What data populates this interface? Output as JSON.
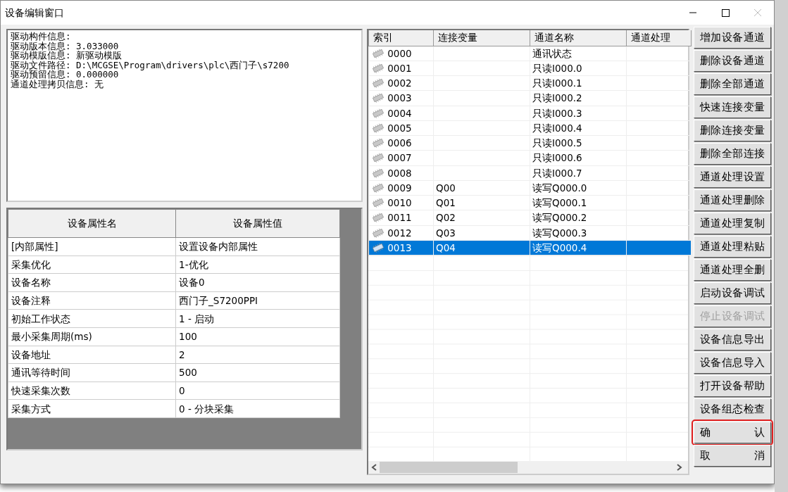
{
  "window": {
    "title": "设备编辑窗口"
  },
  "info_lines": [
    "驱动构件信息:",
    "驱动版本信息: 3.033000",
    "驱动模版信息: 新驱动模版",
    "驱动文件路径: D:\\MCGSE\\Program\\drivers\\plc\\西门子\\s7200",
    "驱动预留信息: 0.000000",
    "通道处理拷贝信息: 无"
  ],
  "properties": {
    "columns": [
      "设备属性名",
      "设备属性值"
    ],
    "rows": [
      [
        "[内部属性]",
        "设置设备内部属性"
      ],
      [
        "采集优化",
        "1-优化"
      ],
      [
        "设备名称",
        "设备0"
      ],
      [
        "设备注释",
        "西门子_S7200PPI"
      ],
      [
        "初始工作状态",
        "1 - 启动"
      ],
      [
        "最小采集周期(ms)",
        "100"
      ],
      [
        "设备地址",
        "2"
      ],
      [
        "通讯等待时间",
        "500"
      ],
      [
        "快速采集次数",
        "0"
      ],
      [
        "采集方式",
        "0 - 分块采集"
      ]
    ]
  },
  "channels": {
    "columns": [
      "索引",
      "连接变量",
      "通道名称",
      "通道处理"
    ],
    "rows": [
      {
        "index": "0000",
        "variable": "",
        "name": "通讯状态",
        "selected": false
      },
      {
        "index": "0001",
        "variable": "",
        "name": "只读I000.0",
        "selected": false
      },
      {
        "index": "0002",
        "variable": "",
        "name": "只读I000.1",
        "selected": false
      },
      {
        "index": "0003",
        "variable": "",
        "name": "只读I000.2",
        "selected": false
      },
      {
        "index": "0004",
        "variable": "",
        "name": "只读I000.3",
        "selected": false
      },
      {
        "index": "0005",
        "variable": "",
        "name": "只读I000.4",
        "selected": false
      },
      {
        "index": "0006",
        "variable": "",
        "name": "只读I000.5",
        "selected": false
      },
      {
        "index": "0007",
        "variable": "",
        "name": "只读I000.6",
        "selected": false
      },
      {
        "index": "0008",
        "variable": "",
        "name": "只读I000.7",
        "selected": false
      },
      {
        "index": "0009",
        "variable": "Q00",
        "name": "读写Q000.0",
        "selected": false
      },
      {
        "index": "0010",
        "variable": "Q01",
        "name": "读写Q000.1",
        "selected": false
      },
      {
        "index": "0011",
        "variable": "Q02",
        "name": "读写Q000.2",
        "selected": false
      },
      {
        "index": "0012",
        "variable": "Q03",
        "name": "读写Q000.3",
        "selected": false
      },
      {
        "index": "0013",
        "variable": "Q04",
        "name": "读写Q000.4",
        "selected": true
      }
    ]
  },
  "buttons": [
    {
      "kind": "text",
      "label": "增加设备通道",
      "disabled": false,
      "highlighted": false
    },
    {
      "kind": "text",
      "label": "删除设备通道",
      "disabled": false,
      "highlighted": false
    },
    {
      "kind": "text",
      "label": "删除全部通道",
      "disabled": false,
      "highlighted": false
    },
    {
      "kind": "text",
      "label": "快速连接变量",
      "disabled": false,
      "highlighted": false
    },
    {
      "kind": "text",
      "label": "删除连接变量",
      "disabled": false,
      "highlighted": false
    },
    {
      "kind": "text",
      "label": "删除全部连接",
      "disabled": false,
      "highlighted": false
    },
    {
      "kind": "text",
      "label": "通道处理设置",
      "disabled": false,
      "highlighted": false
    },
    {
      "kind": "text",
      "label": "通道处理删除",
      "disabled": false,
      "highlighted": false
    },
    {
      "kind": "text",
      "label": "通道处理复制",
      "disabled": false,
      "highlighted": false
    },
    {
      "kind": "text",
      "label": "通道处理粘贴",
      "disabled": false,
      "highlighted": false
    },
    {
      "kind": "text",
      "label": "通道处理全删",
      "disabled": false,
      "highlighted": false
    },
    {
      "kind": "text",
      "label": "启动设备调试",
      "disabled": false,
      "highlighted": false
    },
    {
      "kind": "text",
      "label": "停止设备调试",
      "disabled": true,
      "highlighted": false
    },
    {
      "kind": "text",
      "label": "设备信息导出",
      "disabled": false,
      "highlighted": false
    },
    {
      "kind": "text",
      "label": "设备信息导入",
      "disabled": false,
      "highlighted": false
    },
    {
      "kind": "text",
      "label": "打开设备帮助",
      "disabled": false,
      "highlighted": false
    },
    {
      "kind": "text",
      "label": "设备组态检查",
      "disabled": false,
      "highlighted": false
    },
    {
      "kind": "spread",
      "words": [
        "确",
        "认"
      ],
      "disabled": false,
      "highlighted": true
    },
    {
      "kind": "spread",
      "words": [
        "取",
        "消"
      ],
      "disabled": false,
      "highlighted": false
    }
  ]
}
